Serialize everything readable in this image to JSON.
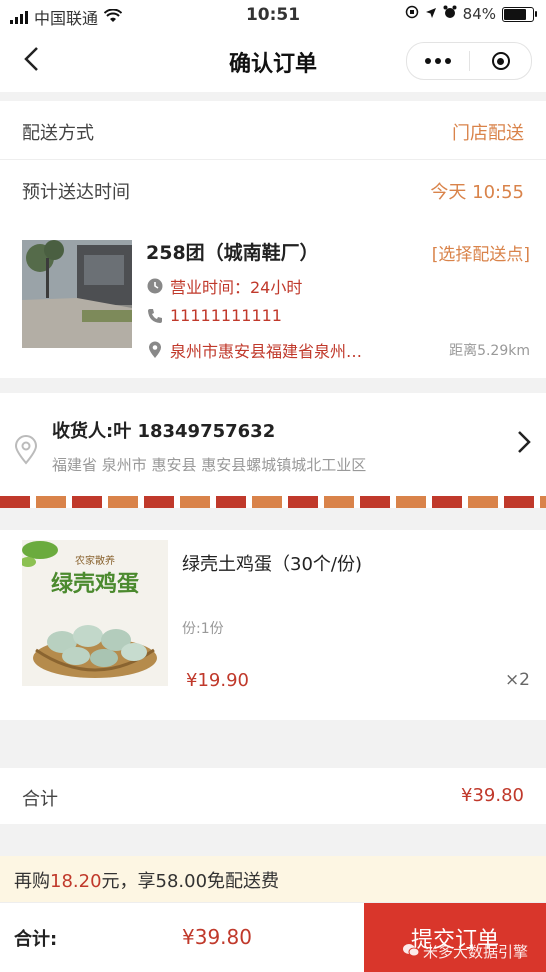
{
  "status_bar": {
    "carrier": "中国联通",
    "time": "10:51",
    "battery": "84%",
    "battery_level": 0.84
  },
  "nav": {
    "title": "确认订单"
  },
  "delivery": {
    "label": "配送方式",
    "value": "门店配送"
  },
  "eta": {
    "label": "预计送达时间",
    "value": "今天 10:55"
  },
  "store": {
    "name": "258团（城南鞋厂）",
    "pick_label": "[选择配送点]",
    "hours": "营业时间：24小时",
    "phone": "11111111111",
    "address": "泉州市惠安县福建省泉州…",
    "distance": "距离5.29km"
  },
  "receiver": {
    "name": "收货人:叶 18349757632",
    "address": "福建省 泉州市 惠安县 惠安县螺城镇城北工业区"
  },
  "goods": {
    "image_text_top": "农家散养",
    "image_text_main": "绿壳鸡蛋",
    "title": "绿壳土鸡蛋（30个/份)",
    "spec": "份:1份",
    "price": "¥19.90",
    "qty": "×2"
  },
  "total": {
    "label": "合计",
    "value": "¥39.80"
  },
  "promo": {
    "prefix": "再购",
    "amount": "18.20",
    "suffix": "元，享58.00免配送费"
  },
  "footer": {
    "label": "合计:",
    "amount": "¥39.80",
    "submit": "提交订单",
    "watermark": "米多大数据引擎"
  },
  "colors": {
    "accent": "#d9362b",
    "orange": "#d9834a",
    "price": "#c0392b"
  }
}
